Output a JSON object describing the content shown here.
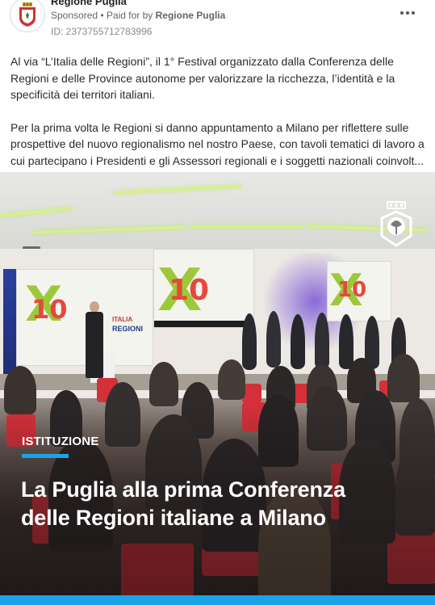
{
  "post": {
    "org_name": "Regione Puglia",
    "sponsored": "Sponsored",
    "separator": " • ",
    "paid_for_by_prefix": "Paid for by ",
    "paid_for_by": "Regione Puglia",
    "id_line": "ID: 2373755712783996",
    "more_icon": "more-horizontal-icon",
    "paragraphs": [
      "Al via “L’Italia delle Regioni”, il 1° Festival organizzato dalla Conferenza delle Regioni e delle Province autonome per valorizzare la ricchezza, l’identità e la specificità dei territori italiani."
    ],
    "paragraph2_lines": [
      "Per la prima volta le Regioni si danno appuntamento a Milano per riflettere sulle",
      "prospettive del nuovo regionalismo nel nostro Paese, con tavoli tematici di lavoro a",
      "cui partecipano i Presidenti e gli Assessori regionali e i soggetti nazionali coinvolt..."
    ]
  },
  "media": {
    "category": "ISTITUZIONE",
    "headline_line1": "La Puglia alla prima Conferenza",
    "headline_line2": "delle Regioni italiane a Milano",
    "accent_color": "#1aa3e8",
    "banner_logo_left": "ITALIA",
    "banner_logo_left_sub": "REGIONI",
    "banner_ten": "10"
  }
}
